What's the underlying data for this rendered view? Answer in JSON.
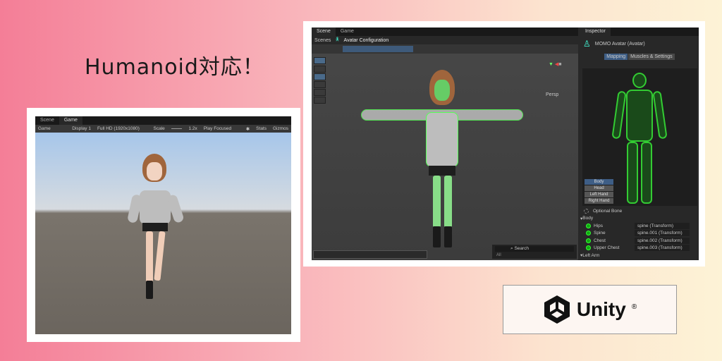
{
  "headline": "Humanoid対応！",
  "game_window": {
    "tabs": [
      "Scene",
      "Game"
    ],
    "toolbar": {
      "mode": "Game",
      "display": "Display 1",
      "resolution": "Full HD (1920x1080)",
      "scale_label": "Scale",
      "scale_value": "1.2x",
      "play_mode": "Play Focused",
      "stats": "Stats",
      "gizmos": "Gizmos"
    }
  },
  "editor": {
    "tabs": [
      "Scene",
      "Game"
    ],
    "breadcrumb": {
      "root": "Scenes",
      "current": "Avatar Configuration"
    },
    "persp": "Persp",
    "search_placeholder": "Search",
    "search_filter": "All",
    "inspector": {
      "tab": "Inspector",
      "object": "MOMO Avatar (Avatar)",
      "subtabs": [
        "Mapping",
        "Muscles & Settings"
      ],
      "body_buttons": [
        "Body",
        "Head",
        "Left Hand",
        "Right Hand"
      ],
      "optional_bone": "Optional Bone",
      "groups": [
        "Body",
        "Left Arm"
      ],
      "bones": [
        {
          "name": "Hips",
          "target": "spine (Transform)"
        },
        {
          "name": "Spine",
          "target": "spine.001 (Transform)"
        },
        {
          "name": "Chest",
          "target": "spine.002 (Transform)"
        },
        {
          "name": "Upper Chest",
          "target": "spine.003 (Transform)"
        }
      ]
    }
  },
  "brand": {
    "name": "Unity",
    "mark": "®"
  }
}
